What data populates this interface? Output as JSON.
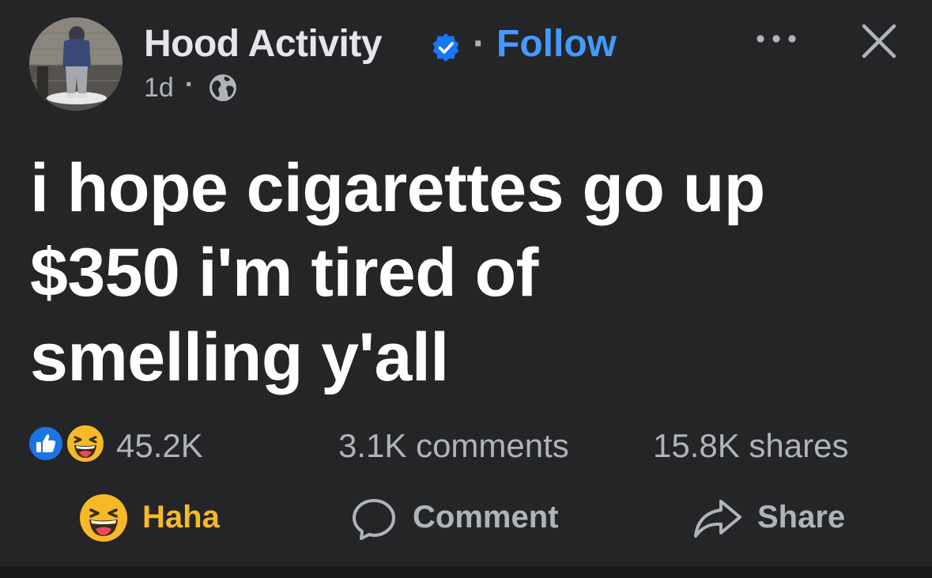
{
  "post": {
    "author": "Hood Activity",
    "follow_label": "Follow",
    "separator": "·",
    "time": "1d",
    "meta_separator": "·",
    "text_lines": [
      "i hope cigarettes go up",
      "$350 i'm tired of",
      "smelling y'all"
    ]
  },
  "stats": {
    "reactions_count": "45.2K",
    "comments": "3.1K comments",
    "shares": "15.8K shares"
  },
  "actions": {
    "reaction_label": "Haha",
    "comment_label": "Comment",
    "share_label": "Share"
  },
  "icons": {
    "verified": "verified-badge-icon",
    "privacy": "globe-icon",
    "more": "more-options-icon",
    "close": "close-icon",
    "like": "like-reaction-icon",
    "haha": "haha-reaction-icon",
    "comment": "comment-bubble-icon",
    "share": "share-arrow-icon"
  },
  "colors": {
    "background": "#242526",
    "follow": "#4599ff",
    "haha": "#f7b928",
    "secondary_text": "#b0b3b8",
    "primary_text": "#ffffff",
    "verified": "#1877f2"
  }
}
